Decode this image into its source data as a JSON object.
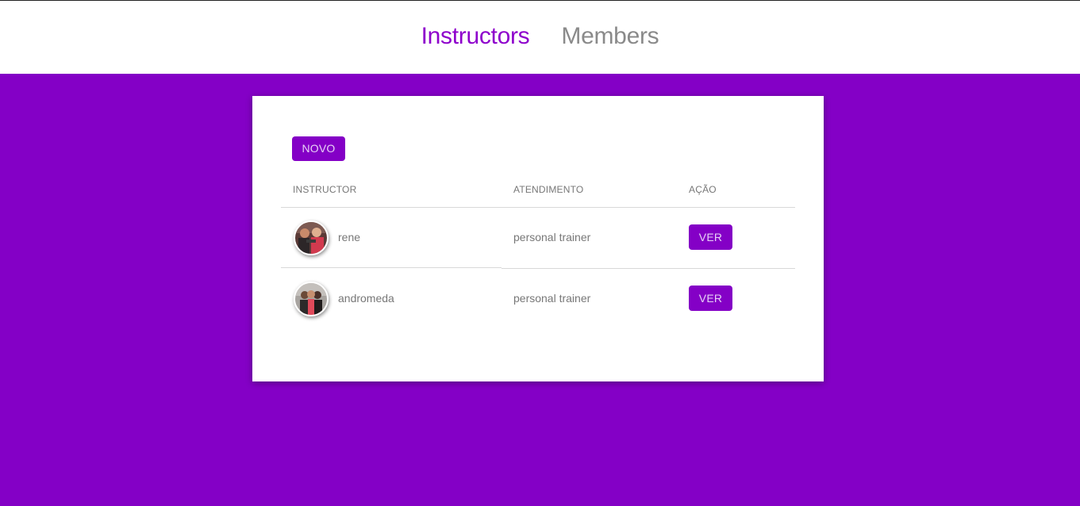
{
  "nav": {
    "instructors": "Instructors",
    "members": "Members"
  },
  "toolbar": {
    "new_label": "NOVO"
  },
  "table": {
    "headers": [
      "INSTRUCTOR",
      "ATENDIMENTO",
      "AÇÃO"
    ],
    "rows": [
      {
        "name": "rene",
        "services": "personal trainer",
        "action": "VER"
      },
      {
        "name": "andromeda",
        "services": "personal trainer",
        "action": "VER"
      }
    ]
  },
  "colors": {
    "primary": "#8400c6",
    "active_nav": "#8e00cc",
    "inactive_nav": "#8a8a8a"
  }
}
